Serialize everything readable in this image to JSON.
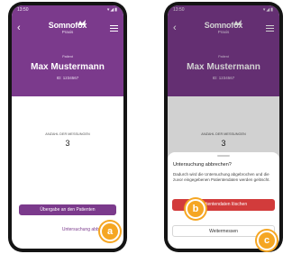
{
  "colors": {
    "brand": "#7b3a8c",
    "danger": "#d23b3b",
    "callout": "#f5a623"
  },
  "status": {
    "time": "13:50",
    "icons": "▾◢▮"
  },
  "header": {
    "app_name": "Somnofox",
    "app_sub": "Praxis",
    "patient_label": "Patient",
    "patient_name": "Max Mustermann",
    "patient_id": "ID: 1234567"
  },
  "measurements": {
    "label": "ANZAHL DER MESSUNGEN",
    "value": "3"
  },
  "actions": {
    "handover": "Übergabe an den Patienten",
    "cancel": "Untersuchung abbrechen"
  },
  "dialog": {
    "title": "Untersuchung abbrechen?",
    "text": "Dadurch wird die Untersuchung abgebrochen und die zuvor eingegebenen Patientendaten werden gelöscht.",
    "delete": "Patientendaten löschen",
    "continue": "Weitermessen"
  },
  "markers": {
    "a": "a",
    "b": "b",
    "c": "c"
  }
}
